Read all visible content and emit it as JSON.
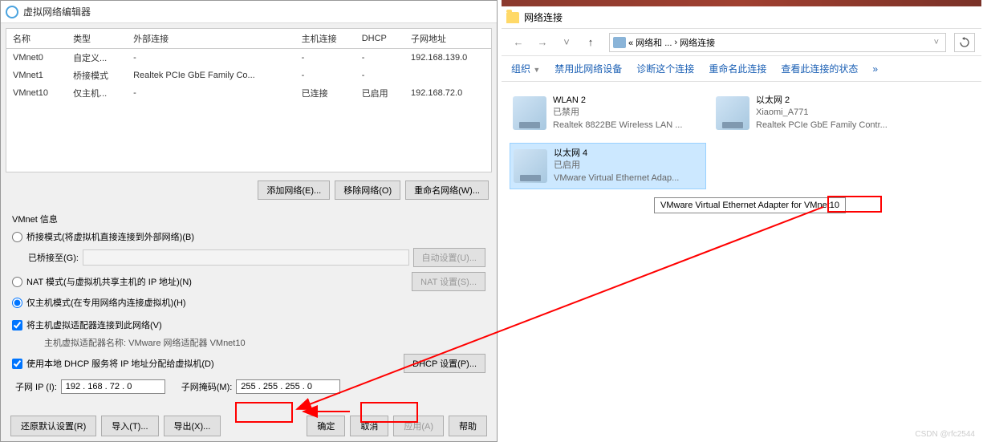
{
  "vne": {
    "title": "虚拟网络编辑器",
    "table": {
      "headers": {
        "name": "名称",
        "type": "类型",
        "external": "外部连接",
        "host": "主机连接",
        "dhcp": "DHCP",
        "subnet": "子网地址"
      },
      "rows": [
        {
          "name": "VMnet0",
          "type": "自定义...",
          "external": "-",
          "host": "-",
          "dhcp": "-",
          "subnet": "192.168.139.0"
        },
        {
          "name": "VMnet1",
          "type": "桥接模式",
          "external": "Realtek PCIe GbE Family Co...",
          "host": "-",
          "dhcp": "-",
          "subnet": ""
        },
        {
          "name": "VMnet10",
          "type": "仅主机...",
          "external": "-",
          "host": "已连接",
          "dhcp": "已启用",
          "subnet": "192.168.72.0"
        }
      ]
    },
    "buttons": {
      "add": "添加网络(E)...",
      "remove": "移除网络(O)",
      "rename": "重命名网络(W)..."
    },
    "info_title": "VMnet 信息",
    "radio_bridge": "桥接模式(将虚拟机直接连接到外部网络)(B)",
    "bridge_to_label": "已桥接至(G):",
    "auto_settings": "自动设置(U)...",
    "radio_nat": "NAT 模式(与虚拟机共享主机的 IP 地址)(N)",
    "nat_settings": "NAT 设置(S)...",
    "radio_host": "仅主机模式(在专用网络内连接虚拟机)(H)",
    "chk_host_adapter": "将主机虚拟适配器连接到此网络(V)",
    "host_adapter_name": "主机虚拟适配器名称: VMware 网络适配器 VMnet10",
    "chk_dhcp": "使用本地 DHCP 服务将 IP 地址分配给虚拟机(D)",
    "dhcp_settings": "DHCP 设置(P)...",
    "subnet_ip_label": "子网 IP (I):",
    "subnet_ip_value": "192 . 168 . 72 . 0",
    "subnet_mask_label": "子网掩码(M):",
    "subnet_mask_value": "255 . 255 . 255 . 0",
    "footer": {
      "restore": "还原默认设置(R)",
      "import": "导入(T)...",
      "export": "导出(X)...",
      "ok": "确定",
      "cancel": "取消",
      "apply": "应用(A)",
      "help": "帮助"
    }
  },
  "nc": {
    "title": "网络连接",
    "breadcrumb": {
      "part1": "« 网络和 ...",
      "sep": "›",
      "part2": "网络连接"
    },
    "commands": {
      "organize": "组织",
      "disable": "禁用此网络设备",
      "diagnose": "诊断这个连接",
      "rename": "重命名此连接",
      "status": "查看此连接的状态",
      "more": "»"
    },
    "items": [
      {
        "title": "WLAN 2",
        "sub1": "已禁用",
        "sub2": "Realtek 8822BE Wireless LAN ..."
      },
      {
        "title": "以太网 2",
        "sub1": "Xiaomi_A771",
        "sub2": "Realtek PCIe GbE Family Contr..."
      },
      {
        "title": "以太网 4",
        "sub1": "已启用",
        "sub2": "VMware Virtual Ethernet Adap..."
      }
    ]
  },
  "tooltip_prefix": "VMware Virtual Ethernet Adapter for ",
  "tooltip_highlight": "VMnet10",
  "watermark": "CSDN @rfc2544"
}
